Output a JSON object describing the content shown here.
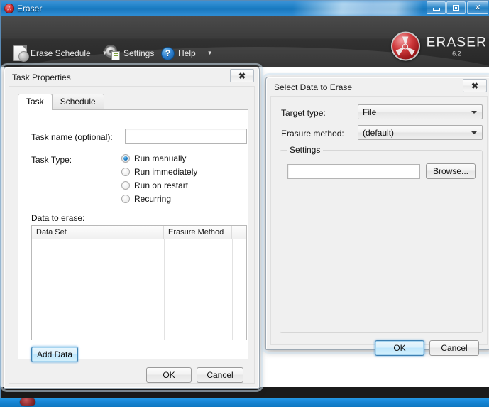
{
  "window": {
    "title": "Eraser",
    "app_icon": "radiation-icon",
    "controls": {
      "minimize": "minimize-button",
      "maximize": "maximize-button",
      "close": "✕"
    }
  },
  "toolbar": {
    "items": [
      {
        "label": "Erase Schedule",
        "icon": "erase-schedule-icon",
        "caret": "▼"
      },
      {
        "label": "Settings",
        "icon": "settings-gear-icon",
        "caret": ""
      },
      {
        "label": "Help",
        "icon": "help-question-icon",
        "caret": "▼"
      }
    ],
    "logo": {
      "name": "ERASER",
      "version": "6.2",
      "mark": "radiation-logo-icon"
    }
  },
  "task_properties": {
    "title": "Task Properties",
    "close_glyph": "✖",
    "tabs": [
      {
        "label": "Task",
        "active": true
      },
      {
        "label": "Schedule",
        "active": false
      }
    ],
    "task_name_label": "Task name (optional):",
    "task_name_value": "",
    "task_name_placeholder": "",
    "task_type_label": "Task Type:",
    "task_types": [
      {
        "label": "Run manually",
        "checked": true
      },
      {
        "label": "Run immediately",
        "checked": false
      },
      {
        "label": "Run on restart",
        "checked": false
      },
      {
        "label": "Recurring",
        "checked": false
      }
    ],
    "data_to_erase_label": "Data to erase:",
    "grid": {
      "columns": [
        "Data Set",
        "Erasure Method",
        ""
      ],
      "rows": []
    },
    "add_data_label": "Add Data",
    "ok_label": "OK",
    "cancel_label": "Cancel"
  },
  "select_data": {
    "title": "Select Data to Erase",
    "close_glyph": "✖",
    "target_type_label": "Target type:",
    "target_type_value": "File",
    "erasure_method_label": "Erasure method:",
    "erasure_method_value": "(default)",
    "settings_group_label": "Settings",
    "path_value": "",
    "path_placeholder": "",
    "browse_label": "Browse...",
    "ok_label": "OK",
    "cancel_label": "Cancel"
  },
  "colors": {
    "titlebar_blue": "#1b7ec4",
    "toolbar_dark": "#323232",
    "logo_red": "#c8282c",
    "focus_blue": "#3c7fb1",
    "desktop_blue": "#1a8ada"
  }
}
